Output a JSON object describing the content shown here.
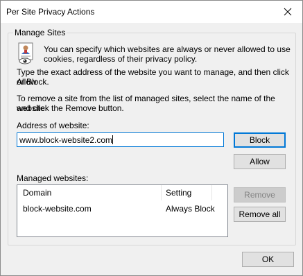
{
  "window": {
    "title": "Per Site Privacy Actions"
  },
  "icons": {
    "close": "close-icon",
    "privacy": "privacy-certificate-eye-icon"
  },
  "group": {
    "label": "Manage Sites",
    "intro_line1": "You can specify which websites are always or never allowed to use",
    "intro_line2": "cookies, regardless of their privacy policy.",
    "instr1_line1": "Type the exact address of the website you want to manage, and then click Allow",
    "instr1_line2": "or Block.",
    "instr2_line1": "To remove a site from the list of managed sites, select the name of the website",
    "instr2_line2": "and click the Remove button."
  },
  "address": {
    "label": "Address of website:",
    "value": "www.block-website2.com"
  },
  "buttons": {
    "block": "Block",
    "allow": "Allow",
    "remove": "Remove",
    "remove_all": "Remove all",
    "ok": "OK"
  },
  "managed": {
    "label": "Managed websites:",
    "columns": [
      "Domain",
      "Setting"
    ],
    "rows": [
      {
        "domain": "block-website.com",
        "setting": "Always Block"
      }
    ]
  }
}
